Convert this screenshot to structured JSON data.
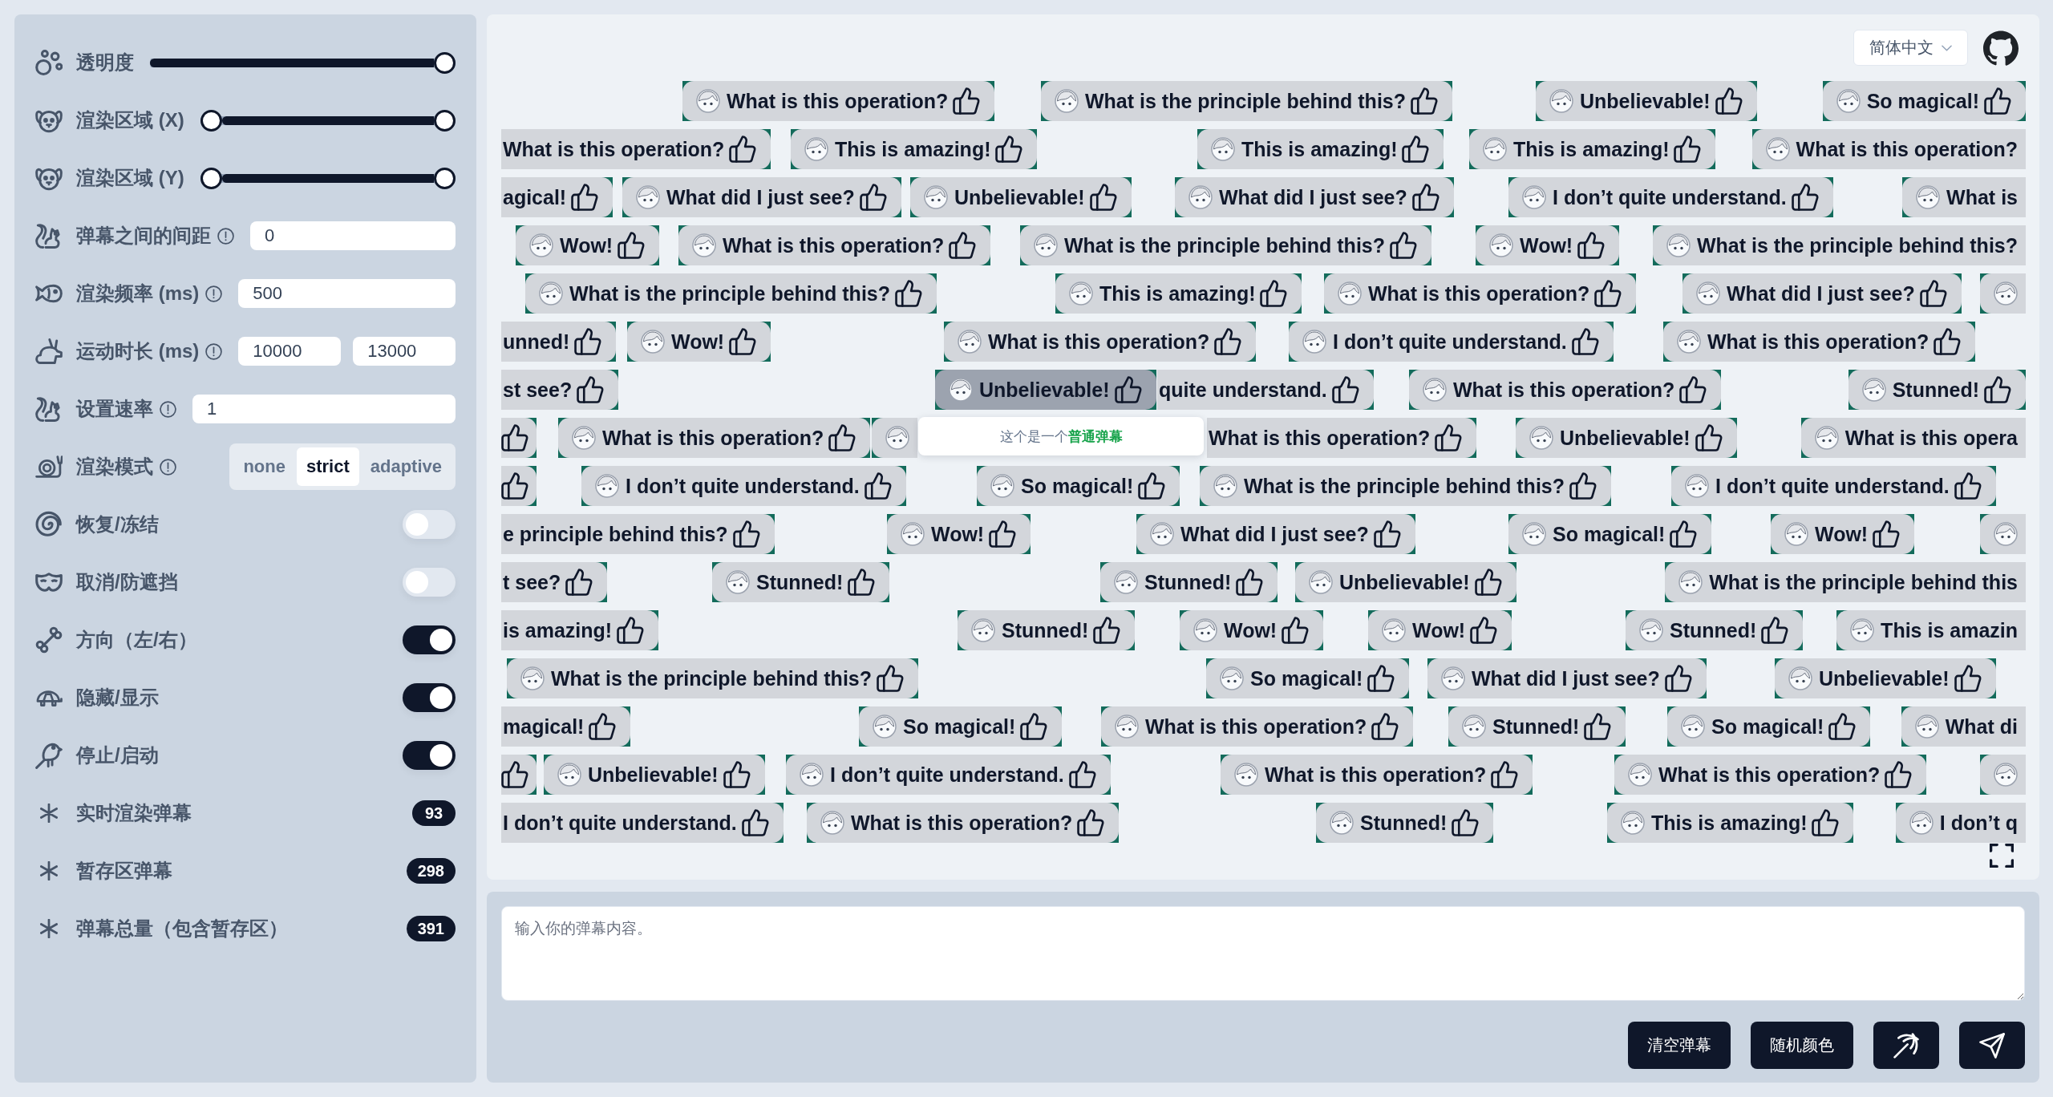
{
  "sidebar": {
    "settings": [
      {
        "kind": "slider",
        "label": "透明度",
        "hint": false,
        "level": 1
      },
      {
        "kind": "range",
        "label": "渲染区域 (X)",
        "hint": false,
        "thumbs": [
          {
            "level": 0
          },
          {
            "level": 1
          }
        ]
      },
      {
        "kind": "range",
        "label": "渲染区域 (Y)",
        "hint": false,
        "thumbs": [
          {
            "level": 0
          },
          {
            "level": 1
          }
        ]
      },
      {
        "kind": "number",
        "label": "弹幕之间的间距",
        "hint": true,
        "value": "0"
      },
      {
        "kind": "number",
        "label": "渲染频率 (ms)",
        "hint": true,
        "value": "500"
      },
      {
        "kind": "number-pair",
        "label": "运动时长 (ms)",
        "hint": true,
        "values": [
          "10000",
          "13000"
        ]
      },
      {
        "kind": "number",
        "label": "设置速率",
        "hint": true,
        "value": "1"
      },
      {
        "kind": "segmented",
        "label": "渲染模式",
        "hint": true,
        "options": [
          {
            "label": "none",
            "selected": false
          },
          {
            "label": "strict",
            "selected": true
          },
          {
            "label": "adaptive",
            "selected": false
          }
        ]
      },
      {
        "kind": "toggle",
        "label": "恢复/冻结",
        "hint": false,
        "on": false
      },
      {
        "kind": "toggle",
        "label": "取消/防遮挡",
        "hint": false,
        "on": false
      },
      {
        "kind": "toggle",
        "label": "方向（左/右）",
        "hint": false,
        "on": true
      },
      {
        "kind": "toggle",
        "label": "隐藏/显示",
        "hint": false,
        "on": true
      },
      {
        "kind": "toggle",
        "label": "停止/启动",
        "hint": false,
        "on": true
      },
      {
        "kind": "count",
        "label": "实时渲染弹幕",
        "hint": false,
        "count": "93"
      },
      {
        "kind": "count",
        "label": "暂存区弹幕",
        "hint": false,
        "count": "298"
      },
      {
        "kind": "count",
        "label": "弹幕总量（包含暂存区）",
        "hint": false,
        "count": "391"
      }
    ]
  },
  "stage": {
    "language": "简体中文",
    "lanes": [
      [
        {
          "kind": "full",
          "text": "What is this operation?",
          "hovered": false
        },
        {
          "kind": "full",
          "text": "What is the principle behind this?",
          "hovered": false
        },
        {
          "kind": "full",
          "text": "Unbelievable!",
          "hovered": false
        },
        {
          "kind": "full",
          "text": "So magical!",
          "hovered": false
        }
      ],
      [
        {
          "kind": "tail",
          "text": "What is this operation?",
          "hovered": false
        },
        {
          "kind": "full",
          "text": "This is amazing!",
          "hovered": false
        },
        {
          "kind": "full",
          "text": "This is amazing!",
          "hovered": false
        },
        {
          "kind": "full",
          "text": "This is amazing!",
          "hovered": false
        },
        {
          "kind": "head",
          "text": "What is this operation?",
          "hovered": false
        }
      ],
      [
        {
          "kind": "tail",
          "text": "agical!",
          "hovered": false
        },
        {
          "kind": "full",
          "text": "What did I just see?",
          "hovered": false
        },
        {
          "kind": "full",
          "text": "Unbelievable!",
          "hovered": false
        },
        {
          "kind": "full",
          "text": "What did I just see?",
          "hovered": false
        },
        {
          "kind": "full",
          "text": "I don’t quite understand.",
          "hovered": false
        },
        {
          "kind": "head",
          "text": "What is",
          "hovered": false
        }
      ],
      [
        {
          "kind": "full",
          "text": "Wow!",
          "hovered": false
        },
        {
          "kind": "full",
          "text": "What is this operation?",
          "hovered": false
        },
        {
          "kind": "full",
          "text": "What is the principle behind this?",
          "hovered": false
        },
        {
          "kind": "full",
          "text": "Wow!",
          "hovered": false
        },
        {
          "kind": "head",
          "text": "What is the principle behind this?",
          "hovered": false
        }
      ],
      [
        {
          "kind": "full",
          "text": "What is the principle behind this?",
          "hovered": false
        },
        {
          "kind": "full",
          "text": "This is amazing!",
          "hovered": false
        },
        {
          "kind": "full",
          "text": "What is this operation?",
          "hovered": false
        },
        {
          "kind": "full",
          "text": "What did I just see?",
          "hovered": false
        },
        {
          "kind": "avatar-only",
          "hovered": false
        }
      ],
      [
        {
          "kind": "tail",
          "text": "unned!",
          "hovered": false
        },
        {
          "kind": "full",
          "text": "Wow!",
          "hovered": false
        },
        {
          "kind": "full",
          "text": "What is this operation?",
          "hovered": false
        },
        {
          "kind": "full",
          "text": "I don’t quite understand.",
          "hovered": false
        },
        {
          "kind": "full",
          "text": "What is this operation?",
          "hovered": false
        }
      ],
      [
        {
          "kind": "tail",
          "text": "st see?",
          "hovered": false
        },
        {
          "kind": "full",
          "text": "Unbelievable!",
          "hovered": true
        },
        {
          "kind": "tail",
          "text": "quite understand.",
          "hovered": false
        },
        {
          "kind": "full",
          "text": "What is this operation?",
          "hovered": false
        },
        {
          "kind": "full",
          "text": "Stunned!",
          "hovered": false
        }
      ],
      [
        {
          "kind": "thumb-only",
          "hovered": false
        },
        {
          "kind": "full",
          "text": "What is this operation?",
          "hovered": false
        },
        {
          "kind": "avatar-only",
          "hovered": false
        },
        {
          "kind": "tail",
          "text": "What is this operation?",
          "hovered": false
        },
        {
          "kind": "full",
          "text": "Unbelievable!",
          "hovered": false
        },
        {
          "kind": "head",
          "text": "What is this opera",
          "hovered": false
        }
      ],
      [
        {
          "kind": "thumb-only",
          "hovered": false
        },
        {
          "kind": "full",
          "text": "I don’t quite understand.",
          "hovered": false
        },
        {
          "kind": "full",
          "text": "So magical!",
          "hovered": false
        },
        {
          "kind": "full",
          "text": "What is the principle behind this?",
          "hovered": false
        },
        {
          "kind": "full",
          "text": "I don’t quite understand.",
          "hovered": false
        }
      ],
      [
        {
          "kind": "tail",
          "text": "e principle behind this?",
          "hovered": false
        },
        {
          "kind": "full",
          "text": "Wow!",
          "hovered": false
        },
        {
          "kind": "full",
          "text": "What did I just see?",
          "hovered": false
        },
        {
          "kind": "full",
          "text": "So magical!",
          "hovered": false
        },
        {
          "kind": "full",
          "text": "Wow!",
          "hovered": false
        },
        {
          "kind": "avatar-only",
          "hovered": false
        }
      ],
      [
        {
          "kind": "tail",
          "text": "t see?",
          "hovered": false
        },
        {
          "kind": "full",
          "text": "Stunned!",
          "hovered": false
        },
        {
          "kind": "full",
          "text": "Stunned!",
          "hovered": false
        },
        {
          "kind": "full",
          "text": "Unbelievable!",
          "hovered": false
        },
        {
          "kind": "head",
          "text": "What is the principle behind this",
          "hovered": false
        }
      ],
      [
        {
          "kind": "tail",
          "text": "is amazing!",
          "hovered": false
        },
        {
          "kind": "full",
          "text": "Stunned!",
          "hovered": false
        },
        {
          "kind": "full",
          "text": "Wow!",
          "hovered": false
        },
        {
          "kind": "full",
          "text": "Wow!",
          "hovered": false
        },
        {
          "kind": "full",
          "text": "Stunned!",
          "hovered": false
        },
        {
          "kind": "head",
          "text": "This is amazin",
          "hovered": false
        }
      ],
      [
        {
          "kind": "full",
          "text": "What is the principle behind this?",
          "hovered": false
        },
        {
          "kind": "full",
          "text": "So magical!",
          "hovered": false
        },
        {
          "kind": "full",
          "text": "What did I just see?",
          "hovered": false
        },
        {
          "kind": "full",
          "text": "Unbelievable!",
          "hovered": false
        }
      ],
      [
        {
          "kind": "tail",
          "text": "magical!",
          "hovered": false
        },
        {
          "kind": "full",
          "text": "So magical!",
          "hovered": false
        },
        {
          "kind": "full",
          "text": "What is this operation?",
          "hovered": false
        },
        {
          "kind": "full",
          "text": "Stunned!",
          "hovered": false
        },
        {
          "kind": "full",
          "text": "So magical!",
          "hovered": false
        },
        {
          "kind": "head",
          "text": "What di",
          "hovered": false
        }
      ],
      [
        {
          "kind": "thumb-only",
          "hovered": false
        },
        {
          "kind": "full",
          "text": "Unbelievable!",
          "hovered": false
        },
        {
          "kind": "full",
          "text": "I don’t quite understand.",
          "hovered": false
        },
        {
          "kind": "full",
          "text": "What is this operation?",
          "hovered": false
        },
        {
          "kind": "full",
          "text": "What is this operation?",
          "hovered": false
        },
        {
          "kind": "avatar-only",
          "hovered": false
        }
      ],
      [
        {
          "kind": "tail",
          "text": "I don’t quite understand.",
          "hovered": false
        },
        {
          "kind": "full",
          "text": "What is this operation?",
          "hovered": false
        },
        {
          "kind": "full",
          "text": "Stunned!",
          "hovered": false
        },
        {
          "kind": "full",
          "text": "This is amazing!",
          "hovered": false
        },
        {
          "kind": "head",
          "text": "I don’t q",
          "hovered": false
        }
      ]
    ],
    "tooltip": "这个是一个**普通弹幕**"
  },
  "composer": {
    "placeholder": "输入你的弹幕内容。",
    "buttons": [
      "清空弹幕",
      "随机颜色"
    ]
  }
}
